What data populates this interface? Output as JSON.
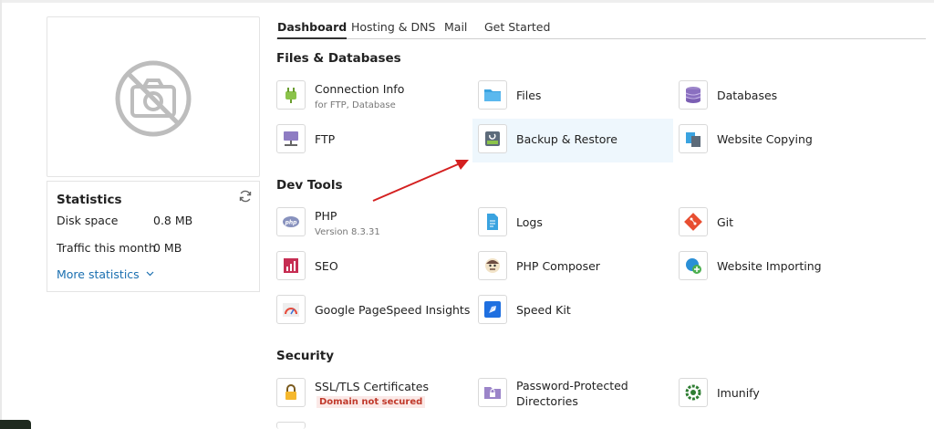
{
  "tabs": [
    "Dashboard",
    "Hosting & DNS",
    "Mail",
    "Get Started"
  ],
  "statistics": {
    "title": "Statistics",
    "disk_label": "Disk space",
    "disk_value": "0.8 MB",
    "traffic_label": "Traffic this month",
    "traffic_value": "0 MB",
    "more": "More statistics"
  },
  "sections": {
    "files": "Files & Databases",
    "dev": "Dev Tools",
    "security": "Security"
  },
  "tools": {
    "connection_info": {
      "name": "Connection Info",
      "sub": "for FTP, Database"
    },
    "files": {
      "name": "Files"
    },
    "databases": {
      "name": "Databases"
    },
    "ftp": {
      "name": "FTP"
    },
    "backup": {
      "name": "Backup & Restore"
    },
    "website_copying": {
      "name": "Website Copying"
    },
    "php": {
      "name": "PHP",
      "sub": "Version 8.3.31"
    },
    "logs": {
      "name": "Logs"
    },
    "git": {
      "name": "Git"
    },
    "seo": {
      "name": "SEO"
    },
    "php_composer": {
      "name": "PHP Composer"
    },
    "website_importing": {
      "name": "Website Importing"
    },
    "pagespeed": {
      "name": "Google PageSpeed Insights"
    },
    "speed_kit": {
      "name": "Speed Kit"
    },
    "ssl": {
      "name": "SSL/TLS Certificates",
      "badge": "Domain not secured"
    },
    "password_dirs": {
      "name": "Password-Protected",
      "name2": "Directories"
    },
    "imunify": {
      "name": "Imunify"
    }
  },
  "colors": {
    "link": "#1a6fb0",
    "highlight": "#eef7fd",
    "annotation_arrow": "#d42020",
    "warning": "#c0392b"
  }
}
